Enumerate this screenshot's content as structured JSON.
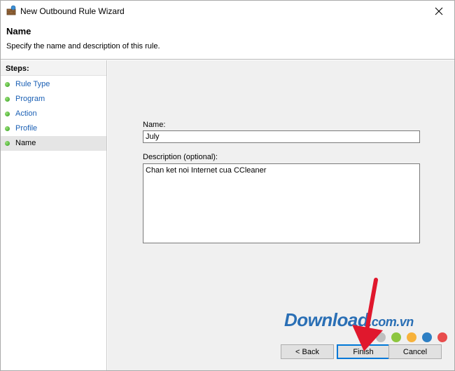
{
  "window": {
    "title": "New Outbound Rule Wizard"
  },
  "header": {
    "title": "Name",
    "description": "Specify the name and description of this rule."
  },
  "steps": {
    "title": "Steps:",
    "items": [
      {
        "label": "Rule Type",
        "current": false
      },
      {
        "label": "Program",
        "current": false
      },
      {
        "label": "Action",
        "current": false
      },
      {
        "label": "Profile",
        "current": false
      },
      {
        "label": "Name",
        "current": true
      }
    ]
  },
  "form": {
    "name_label": "Name:",
    "name_value": "July",
    "description_label": "Description (optional):",
    "description_value": "Chan ket noi Internet cua CCleaner"
  },
  "buttons": {
    "back": "< Back",
    "finish": "Finish",
    "cancel": "Cancel"
  },
  "watermark": {
    "brand": "Download",
    "domain": ".com.vn",
    "dot_colors": [
      "#3d9be0",
      "#bfbfbf",
      "#8dc63f",
      "#f7b23b",
      "#2d7fc4",
      "#e84c4c"
    ]
  },
  "colors": {
    "step_link": "#1a5fb4",
    "step_dot": "#2f9c1b",
    "default_button_border": "#0078d7",
    "arrow": "#e0182d"
  },
  "icons": {
    "app": "firewall-shield-icon",
    "close": "close-icon",
    "step": "green-dot-icon"
  }
}
